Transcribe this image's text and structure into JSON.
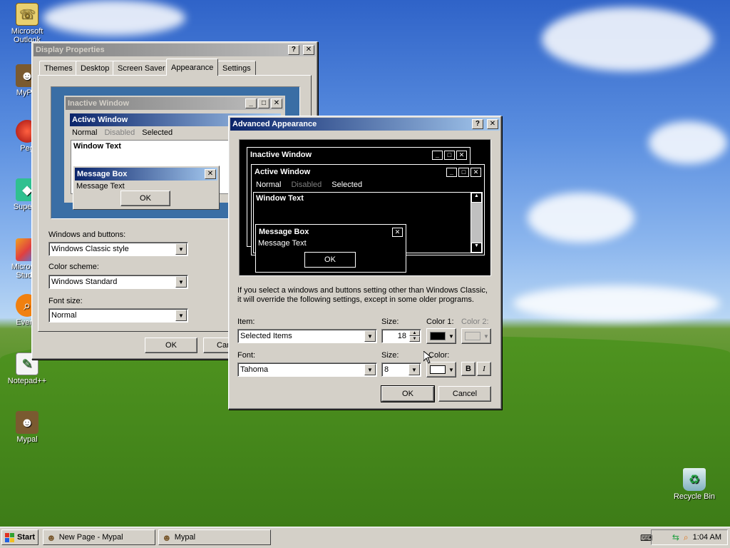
{
  "desktop_icons": [
    {
      "label": "Microsoft Outlook",
      "icon": "outlook-icon"
    },
    {
      "label": "MyPal",
      "icon": "mypal-shortcut-icon"
    },
    {
      "label": "Peg",
      "icon": "peg-icon"
    },
    {
      "label": "Superm",
      "icon": "superm-icon"
    },
    {
      "label": "Microsoft Studio",
      "icon": "studio-icon"
    },
    {
      "label": "Everyt",
      "icon": "everything-icon"
    },
    {
      "label": "Notepad++",
      "icon": "notepadpp-icon"
    },
    {
      "label": "Mypal",
      "icon": "mypal-icon"
    },
    {
      "label": "Recycle Bin",
      "icon": "recycle-bin-icon"
    }
  ],
  "display_properties": {
    "title": "Display Properties",
    "help_btn": "?",
    "close_btn": "✕",
    "tabs": [
      "Themes",
      "Desktop",
      "Screen Saver",
      "Appearance",
      "Settings"
    ],
    "preview": {
      "inactive_title": "Inactive Window",
      "active_title": "Active Window",
      "menu_normal": "Normal",
      "menu_disabled": "Disabled",
      "menu_selected": "Selected",
      "window_text": "Window Text",
      "msgbox_title": "Message Box",
      "msgbox_text": "Message Text",
      "msgbox_ok": "OK"
    },
    "windows_buttons_label": "Windows and buttons:",
    "windows_buttons_value": "Windows Classic style",
    "color_scheme_label": "Color scheme:",
    "color_scheme_value": "Windows Standard",
    "font_size_label": "Font size:",
    "font_size_value": "Normal",
    "ok": "OK",
    "cancel": "Can"
  },
  "advanced_appearance": {
    "title": "Advanced Appearance",
    "help_btn": "?",
    "close_btn": "✕",
    "preview": {
      "inactive_title": "Inactive Window",
      "active_title": "Active Window",
      "menu_normal": "Normal",
      "menu_disabled": "Disabled",
      "menu_selected": "Selected",
      "window_text": "Window Text",
      "msgbox_title": "Message Box",
      "msgbox_text": "Message Text",
      "msgbox_ok": "OK"
    },
    "info_line1": "If you select a windows and buttons setting other than Windows Classic,",
    "info_line2": "it will override the following settings, except in some older programs.",
    "item_label": "Item:",
    "item_value": "Selected Items",
    "size_label": "Size:",
    "size_value": "18",
    "color1_label": "Color 1:",
    "color2_label": "Color 2:",
    "font_label": "Font:",
    "font_value": "Tahoma",
    "font_size_label": "Size:",
    "font_size_value": "8",
    "font_color_label": "Color:",
    "bold_btn": "B",
    "italic_btn": "I",
    "ok": "OK",
    "cancel": "Cancel",
    "color1": "#000000",
    "font_color": "#ffffff"
  },
  "taskbar": {
    "start": "Start",
    "tasks": [
      {
        "label": "New Page - Mypal"
      },
      {
        "label": "Mypal"
      }
    ],
    "clock": "1:04 AM"
  },
  "colors": {
    "title_active": "#0a246a",
    "title_gradient_end": "#a6caf0",
    "face": "#d4d0c8",
    "preview_bg": "#3a6ea5"
  }
}
